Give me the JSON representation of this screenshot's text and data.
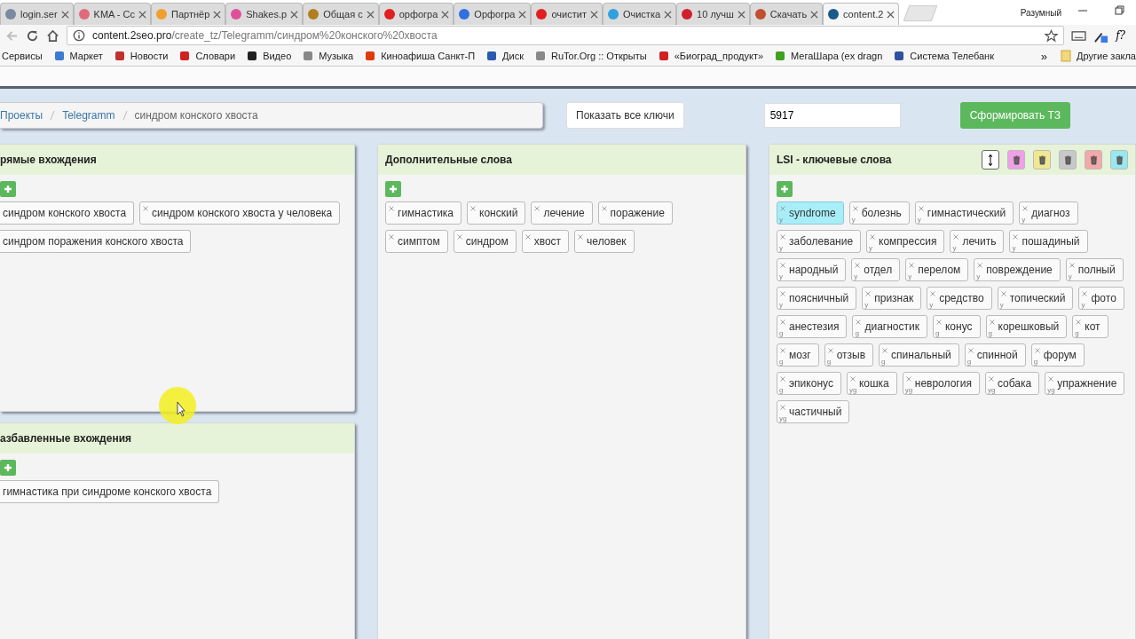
{
  "browser": {
    "tabs": [
      {
        "title": "login.ser",
        "selected": false,
        "color": "#7a8aa0"
      },
      {
        "title": "KMA - Сс",
        "selected": false,
        "color": "#e06a7a"
      },
      {
        "title": "Партнёр",
        "selected": false,
        "color": "#f0a030"
      },
      {
        "title": "Shakes.p",
        "selected": false,
        "color": "#e0509a"
      },
      {
        "title": "Общая с",
        "selected": false,
        "color": "#b08020"
      },
      {
        "title": "орфогра",
        "selected": false,
        "color": "#e02020"
      },
      {
        "title": "Орфогра",
        "selected": false,
        "color": "#3070e0"
      },
      {
        "title": "очистит",
        "selected": false,
        "color": "#e02020"
      },
      {
        "title": "Очистка",
        "selected": false,
        "color": "#30a0e0"
      },
      {
        "title": "10 лучш",
        "selected": false,
        "color": "#d02030"
      },
      {
        "title": "Скачать",
        "selected": false,
        "color": "#c05030"
      },
      {
        "title": "content.2",
        "selected": true,
        "color": "#1a5a8a"
      }
    ],
    "profile": "Разумный",
    "url": {
      "host": "content.2seo.pro",
      "path": "/create_tz/Telegramm/синдром%20конского%20хвоста"
    },
    "extension_label": "f?",
    "bookmarks": [
      {
        "title": "Сервисы"
      },
      {
        "title": "Маркет",
        "color": "#3a7ad0"
      },
      {
        "title": "Новости",
        "color": "#c03030"
      },
      {
        "title": "Словари",
        "color": "#d02020"
      },
      {
        "title": "Видео",
        "color": "#202020"
      },
      {
        "title": "Музыка",
        "color": "#888888"
      },
      {
        "title": "Киноафиша Санкт-П",
        "color": "#e03a10"
      },
      {
        "title": "Диск",
        "color": "#2a5ab0"
      },
      {
        "title": "RuTor.Org :: Открыты",
        "color": "#888888"
      },
      {
        "title": "«Биоград_продукт»",
        "color": "#d02020"
      },
      {
        "title": "МегаШара (ex dragn",
        "color": "#40a020"
      },
      {
        "title": "Система Телебанк",
        "color": "#3050a0"
      }
    ],
    "bookmarks_more": "»",
    "other_bookmarks": "Другие закла"
  },
  "page": {
    "breadcrumb": [
      "Проекты",
      "Telegramm",
      "синдром конского хвоста"
    ],
    "show_keys_button": "Показать все ключи",
    "count_field": "5917",
    "generate_button": "Сформировать ТЗ",
    "columns": [
      {
        "panels": [
          {
            "title": "рямые вхождения",
            "tags": [
              {
                "text": "синдром конского хвоста",
                "cut": true
              },
              {
                "text": "синдром конского хвоста у человека",
                "cut": false
              },
              {
                "text": "синдром поражения конского хвоста",
                "cut": true
              }
            ]
          },
          {
            "title": "азбавленные вхождения",
            "tags": [
              {
                "text": "гимнастика при синдроме конского хвоста",
                "cut": true
              }
            ]
          }
        ]
      },
      {
        "panels": [
          {
            "title": "Дополнительные слова",
            "tags": [
              {
                "text": "гимнастика"
              },
              {
                "text": "конский"
              },
              {
                "text": "лечение"
              },
              {
                "text": "поражение"
              },
              {
                "text": "симптом"
              },
              {
                "text": "синдром"
              },
              {
                "text": "хвост"
              },
              {
                "text": "человек"
              }
            ]
          }
        ]
      },
      {
        "panels": [
          {
            "title": "LSI - ключевые слова",
            "trash_buttons": [
              {
                "color": "#f0a0e8"
              },
              {
                "color": "#f0e890"
              },
              {
                "color": "#c8c8c8"
              },
              {
                "color": "#f4a8a8"
              },
              {
                "color": "#98e8f0"
              }
            ],
            "tags": [
              {
                "text": "syndrome",
                "sub": "y",
                "selected": true
              },
              {
                "text": "болезнь",
                "sub": "y",
                "selected": false
              },
              {
                "text": "гимнастический",
                "sub": "y",
                "selected": false
              },
              {
                "text": "диагноз",
                "sub": "y",
                "selected": false
              },
              {
                "text": "заболевание",
                "sub": "y",
                "selected": false
              },
              {
                "text": "компрессия",
                "sub": "y",
                "selected": false
              },
              {
                "text": "лечить",
                "sub": "y",
                "selected": false
              },
              {
                "text": "пошадиный",
                "sub": "y",
                "selected": false
              },
              {
                "text": "народный",
                "sub": "y",
                "selected": false
              },
              {
                "text": "отдел",
                "sub": "y",
                "selected": false
              },
              {
                "text": "перелом",
                "sub": "y",
                "selected": false
              },
              {
                "text": "повреждение",
                "sub": "y",
                "selected": false
              },
              {
                "text": "полный",
                "sub": "y",
                "selected": false
              },
              {
                "text": "поясничный",
                "sub": "y",
                "selected": false
              },
              {
                "text": "признак",
                "sub": "y",
                "selected": false
              },
              {
                "text": "средство",
                "sub": "y",
                "selected": false
              },
              {
                "text": "топический",
                "sub": "y",
                "selected": false
              },
              {
                "text": "фото",
                "sub": "y",
                "selected": false
              },
              {
                "text": "анестезия",
                "sub": "g",
                "selected": false
              },
              {
                "text": "диагностик",
                "sub": "g",
                "selected": false
              },
              {
                "text": "конус",
                "sub": "g",
                "selected": false
              },
              {
                "text": "корешковый",
                "sub": "g",
                "selected": false
              },
              {
                "text": "кот",
                "sub": "g",
                "selected": false
              },
              {
                "text": "мозг",
                "sub": "g",
                "selected": false
              },
              {
                "text": "отзыв",
                "sub": "g",
                "selected": false
              },
              {
                "text": "спинальный",
                "sub": "g",
                "selected": false
              },
              {
                "text": "спинной",
                "sub": "g",
                "selected": false
              },
              {
                "text": "форум",
                "sub": "g",
                "selected": false
              },
              {
                "text": "эпиконус",
                "sub": "g",
                "selected": false
              },
              {
                "text": "кошка",
                "sub": "yg",
                "selected": false
              },
              {
                "text": "неврология",
                "sub": "yg",
                "selected": false
              },
              {
                "text": "собака",
                "sub": "yg",
                "selected": false
              },
              {
                "text": "упражнение",
                "sub": "yg",
                "selected": false
              },
              {
                "text": "частичный",
                "sub": "yg",
                "selected": false
              }
            ]
          }
        ]
      }
    ]
  }
}
